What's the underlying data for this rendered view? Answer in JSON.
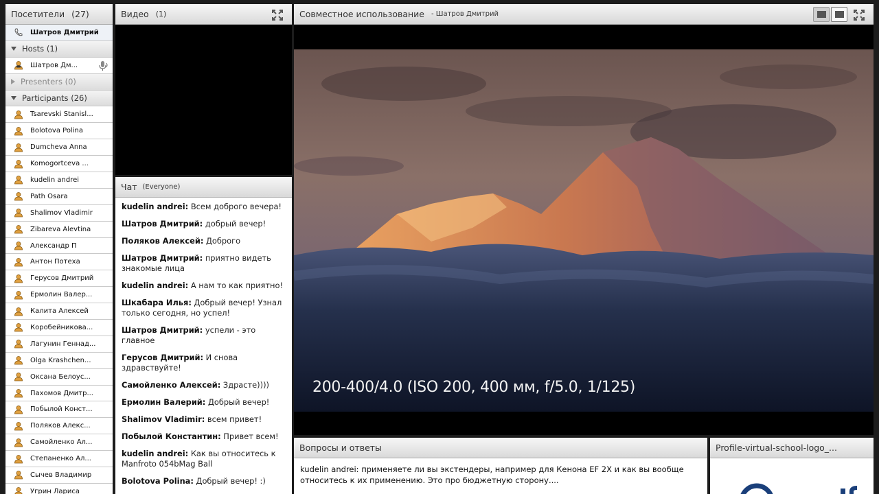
{
  "attendees": {
    "title": "Посетители",
    "count": "(27)",
    "me": "Шатров Дмитрий",
    "hosts_label": "Hosts (1)",
    "hosts": [
      "Шатров Дм..."
    ],
    "presenters_label": "Presenters (0)",
    "participants_label": "Participants (26)",
    "participants": [
      "Tsarevski Stanisl...",
      "Bolotova Polina",
      "Dumcheva Anna",
      "Komogortceva ...",
      "kudelin andrei",
      "Path Osara",
      "Shalimov Vladimir",
      "Zibareva Alevtina",
      "Александр П",
      "Антон Потеха",
      "Герусов Дмитрий",
      "Ермолин Валер...",
      "Калита Алексей",
      "Коробейникова...",
      "Лагунин Геннад...",
      "Olga Krashchen...",
      "Оксана Белоус...",
      "Пахомов Дмитр...",
      "Побылой Конст...",
      "Поляков Алекс...",
      "Самойленко Ал...",
      "Степаненко Ал...",
      "Сычев Владимир",
      "Угрин Лариса"
    ]
  },
  "video": {
    "title": "Видео",
    "count": "(1)"
  },
  "chat": {
    "title": "Чат",
    "audience": "(Everyone)",
    "messages": [
      {
        "author": "kudelin andrei:",
        "text": " Всем доброго вечера!"
      },
      {
        "author": "Шатров Дмитрий:",
        "text": " добрый вечер!"
      },
      {
        "author": "Поляков Алексей:",
        "text": " Доброго"
      },
      {
        "author": "Шатров Дмитрий:",
        "text": " приятно видеть знакомые лица"
      },
      {
        "author": "kudelin andrei:",
        "text": " А нам то как приятно!"
      },
      {
        "author": "Шкабара Илья:",
        "text": " Добрый вечер! Узнал только сегодня, но успел!"
      },
      {
        "author": "Шатров Дмитрий:",
        "text": " успели - это главное"
      },
      {
        "author": "Герусов Дмитрий:",
        "text": " И снова здравствуйте!"
      },
      {
        "author": "Самойленко Алексей:",
        "text": " Здрасте))))"
      },
      {
        "author": "Ермолин Валерий:",
        "text": " Добрый вечер!"
      },
      {
        "author": "Shalimov Vladimir:",
        "text": " всем привет!"
      },
      {
        "author": "Побылой Константин:",
        "text": " Привет всем!"
      },
      {
        "author": "kudelin andrei:",
        "text": " Как вы относитесь к Manfroto 054bMag Ball"
      },
      {
        "author": "Bolotova Polina:",
        "text": " Добрый вечер! :)"
      }
    ]
  },
  "share": {
    "title": "Совместное использование",
    "presenter": "- Шатров Дмитрий",
    "caption": "200-400/4.0 (ISO 200, 400 мм, f/5.0, 1/125)"
  },
  "qa": {
    "title": "Вопросы и ответы",
    "question": "kudelin andrei: применяете ли вы экстендеры, например для Кенона EF 2X и как вы вообще относитесь к их применению. Это про бюджетную сторону...."
  },
  "logo_pod": {
    "title": "Profile-virtual-school-logo_..."
  },
  "colors": {
    "chrome_bg": "#1c1c1c",
    "header_gradient_top": "#f7f7f7",
    "header_gradient_bottom": "#d9d9d9",
    "user_icon": "#e0a040"
  }
}
